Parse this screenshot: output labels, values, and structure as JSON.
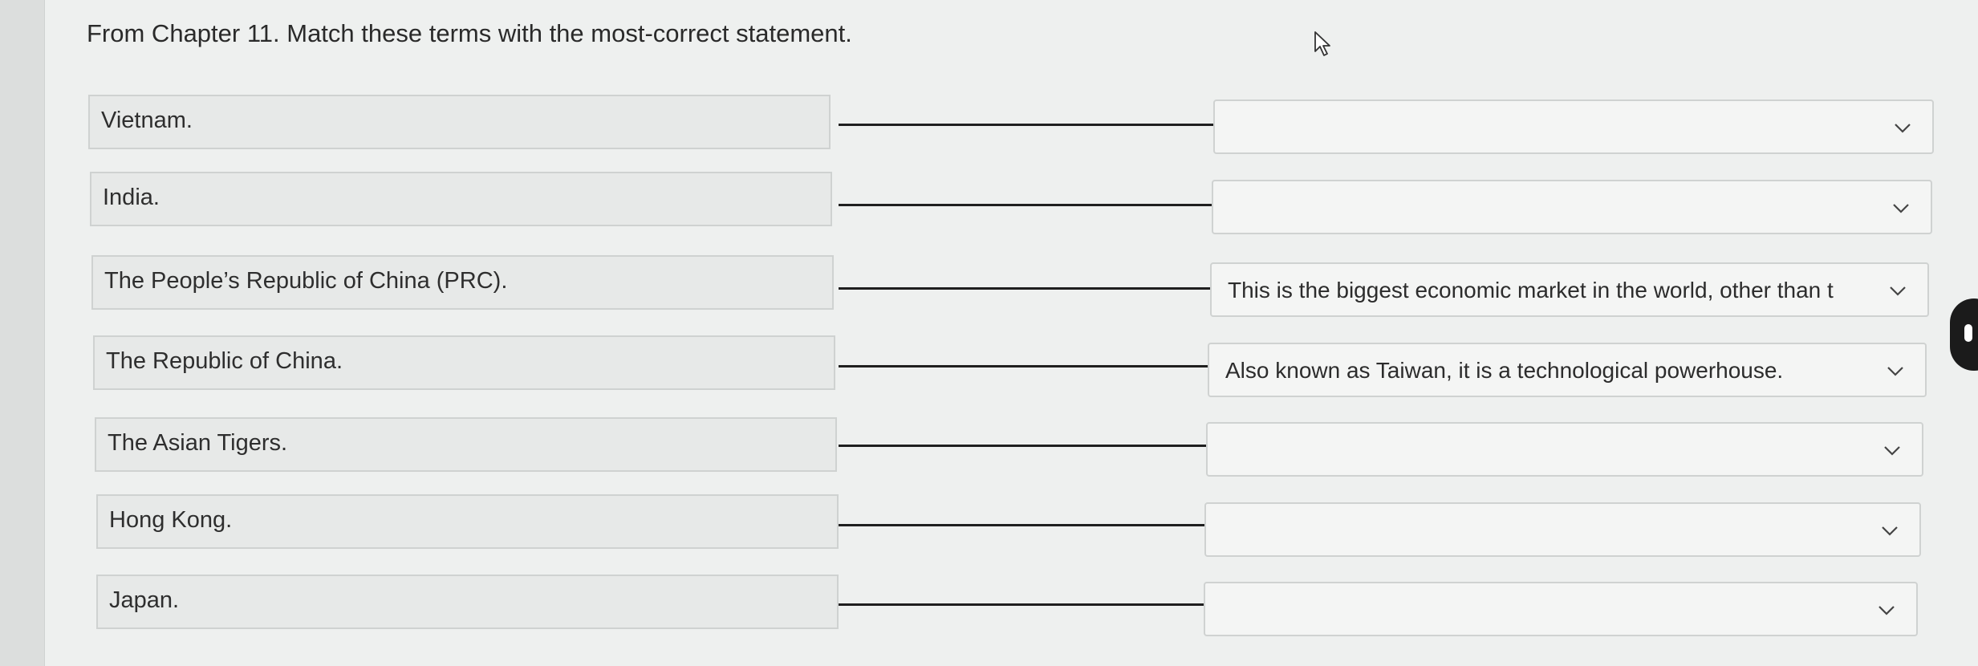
{
  "question": {
    "title": "From Chapter 11. Match these terms with the most-correct statement."
  },
  "matches": [
    {
      "term": "Vietnam.",
      "answer": ""
    },
    {
      "term": "India.",
      "answer": ""
    },
    {
      "term": "The People’s Republic of China (PRC).",
      "answer": "This is the biggest economic market in the world, other than t"
    },
    {
      "term": "The Republic of China.",
      "answer": "Also known as Taiwan, it is a technological powerhouse."
    },
    {
      "term": "The Asian Tigers.",
      "answer": ""
    },
    {
      "term": "Hong Kong.",
      "answer": ""
    },
    {
      "term": "Japan.",
      "answer": ""
    }
  ],
  "icons": {
    "dropdown": "chevron-down-icon",
    "cursor": "mouse-pointer-icon"
  },
  "colors": {
    "background": "#eef0ef",
    "box": "#e7e9e8",
    "border": "#cfd2d1",
    "connector": "#1f1f1f"
  }
}
